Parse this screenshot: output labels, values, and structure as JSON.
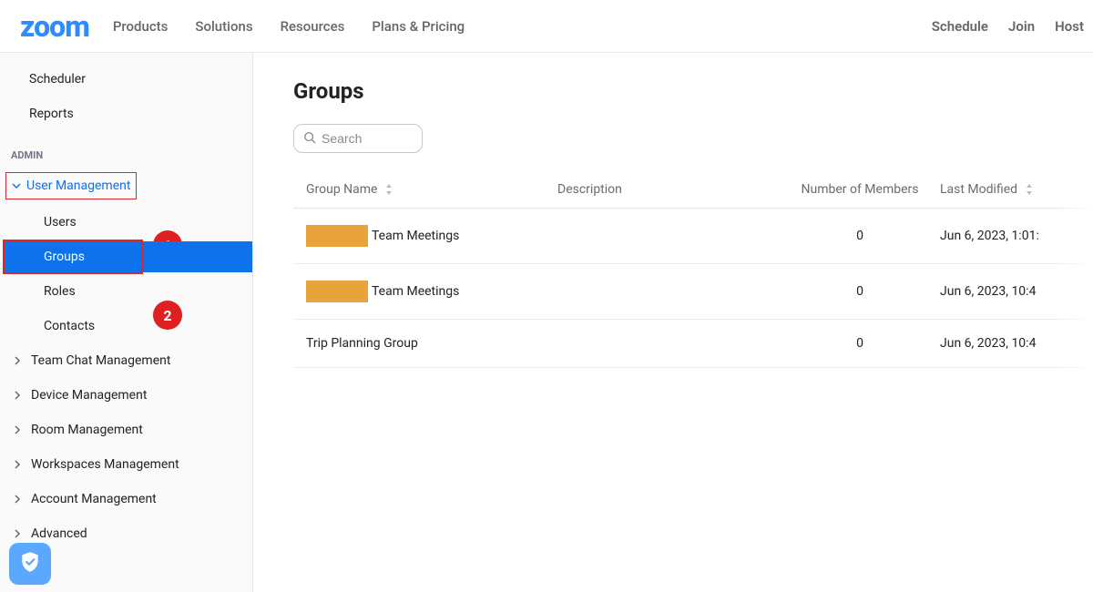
{
  "header": {
    "logo": "zoom",
    "nav_left": [
      "Products",
      "Solutions",
      "Resources",
      "Plans & Pricing"
    ],
    "nav_right": [
      "Schedule",
      "Join",
      "Host"
    ]
  },
  "sidebar": {
    "top_items": [
      "Scheduler",
      "Reports"
    ],
    "admin_heading": "ADMIN",
    "user_management": {
      "label": "User Management",
      "children": [
        "Users",
        "Groups",
        "Roles",
        "Contacts"
      ]
    },
    "bottom_sections": [
      "Team Chat Management",
      "Device Management",
      "Room Management",
      "Workspaces Management",
      "Account Management",
      "Advanced"
    ]
  },
  "callouts": {
    "one": "1",
    "two": "2"
  },
  "main": {
    "title": "Groups",
    "search_placeholder": "Search",
    "columns": {
      "name": "Group Name",
      "description": "Description",
      "members": "Number of Members",
      "modified": "Last Modified"
    },
    "rows": [
      {
        "name_prefix_redacted": true,
        "name_suffix": "Team Meetings",
        "description": "",
        "members": "0",
        "modified": "Jun 6, 2023, 1:01:"
      },
      {
        "name_prefix_redacted": true,
        "name_suffix": "Team Meetings",
        "description": "",
        "members": "0",
        "modified": "Jun 6, 2023, 10:4"
      },
      {
        "name_prefix_redacted": false,
        "name_suffix": "Trip Planning Group",
        "description": "",
        "members": "0",
        "modified": "Jun 6, 2023, 10:4"
      }
    ]
  }
}
